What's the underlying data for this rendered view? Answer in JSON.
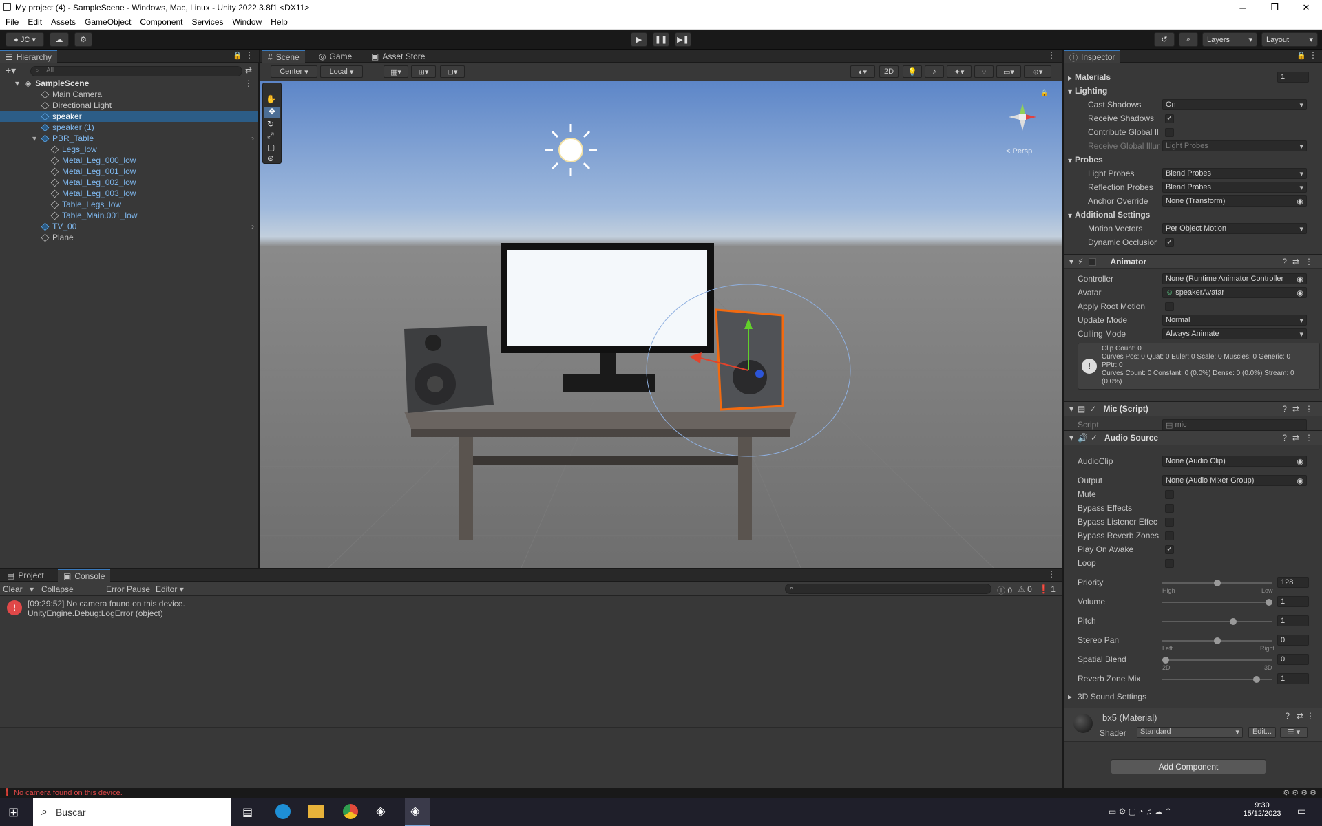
{
  "window": {
    "title": "My project (4) - SampleScene - Windows, Mac, Linux - Unity 2022.3.8f1 <DX11>"
  },
  "menu": [
    "File",
    "Edit",
    "Assets",
    "GameObject",
    "Component",
    "Services",
    "Window",
    "Help"
  ],
  "toolbar": {
    "account": "JC",
    "layers": "Layers",
    "layout": "Layout"
  },
  "hierarchy": {
    "tab": "Hierarchy",
    "search_placeholder": "All",
    "scene": "SampleScene",
    "items": [
      "Main Camera",
      "Directional Light",
      "speaker",
      "speaker (1)",
      "PBR_Table",
      "Legs_low",
      "Metal_Leg_000_low",
      "Metal_Leg_001_low",
      "Metal_Leg_002_low",
      "Metal_Leg_003_low",
      "Table_Legs_low",
      "Table_Main.001_low",
      "TV_00",
      "Plane"
    ]
  },
  "scene_tabs": [
    "Scene",
    "Game",
    "Asset Store"
  ],
  "scene_toolbar": {
    "pivot": "Center",
    "space": "Local",
    "mode2d": "2D",
    "persp": "< Persp"
  },
  "console": {
    "tabs": [
      "Project",
      "Console"
    ],
    "buttons": [
      "Clear",
      "Collapse",
      "Error Pause",
      "Editor"
    ],
    "counts": {
      "info": "0",
      "warn": "0",
      "error": "1"
    },
    "log_line1": "[09:29:52] No camera found on this device.",
    "log_line2": "UnityEngine.Debug:LogError (object)"
  },
  "inspector": {
    "tab": "Inspector",
    "materials_label": "Materials",
    "materials_count": "1",
    "lighting": "Lighting",
    "cast_shadows_label": "Cast Shadows",
    "cast_shadows": "On",
    "receive_shadows": "Receive Shadows",
    "contribute_gi": "Contribute Global Il",
    "receive_gi": "Receive Global Illur",
    "receive_gi_value": "Light Probes",
    "probes": "Probes",
    "light_probes_label": "Light Probes",
    "light_probes": "Blend Probes",
    "reflection_probes_label": "Reflection Probes",
    "reflection_probes": "Blend Probes",
    "anchor_label": "Anchor Override",
    "anchor": "None (Transform)",
    "additional": "Additional Settings",
    "motion_vectors_label": "Motion Vectors",
    "motion_vectors": "Per Object Motion",
    "dynamic_occlusion": "Dynamic Occlusior",
    "animator": "Animator",
    "controller_label": "Controller",
    "controller": "None (Runtime Animator Controller",
    "avatar_label": "Avatar",
    "avatar": "speakerAvatar",
    "apply_root": "Apply Root Motion",
    "update_mode_label": "Update Mode",
    "update_mode": "Normal",
    "culling_label": "Culling Mode",
    "culling": "Always Animate",
    "info1": "Clip Count: 0",
    "info2": "Curves Pos: 0 Quat: 0 Euler: 0 Scale: 0 Muscles: 0 Generic: 0",
    "info3": "PPtr: 0",
    "info4": "Curves Count: 0 Constant: 0 (0.0%) Dense: 0 (0.0%) Stream: 0",
    "info5": "(0.0%)",
    "mic": "Mic (Script)",
    "script_label": "Script",
    "script": "mic",
    "audio": "Audio Source",
    "audioclip_label": "AudioClip",
    "audioclip": "None (Audio Clip)",
    "output_label": "Output",
    "output": "None (Audio Mixer Group)",
    "mute": "Mute",
    "bypass_effects": "Bypass Effects",
    "bypass_listener": "Bypass Listener Effec",
    "bypass_reverb": "Bypass Reverb Zones",
    "play_on_awake": "Play On Awake",
    "loop": "Loop",
    "priority_label": "Priority",
    "priority": "128",
    "high": "High",
    "low": "Low",
    "volume_label": "Volume",
    "volume": "1",
    "pitch_label": "Pitch",
    "pitch": "1",
    "stereo_label": "Stereo Pan",
    "stereo": "0",
    "left": "Left",
    "right": "Right",
    "spatial_label": "Spatial Blend",
    "spatial": "0",
    "two_d": "2D",
    "three_d": "3D",
    "reverb_label": "Reverb Zone Mix",
    "reverb": "1",
    "sound3d": "3D Sound Settings",
    "material": "bx5 (Material)",
    "shader_label": "Shader",
    "shader": "Standard",
    "edit": "Edit...",
    "add_component": "Add Component"
  },
  "slider_levels": {
    "priority": 0.5,
    "volume": 1.0,
    "pitch": 0.65,
    "stereo": 0.5,
    "spatial": 0.0,
    "reverb": 0.88
  },
  "status": "No camera found on this device.",
  "taskbar": {
    "search": "Buscar",
    "time": "9:30",
    "date": "15/12/2023"
  },
  "colors": {
    "selection": "#2c5d87",
    "error": "#e04848",
    "accent": "#3a79bb"
  }
}
